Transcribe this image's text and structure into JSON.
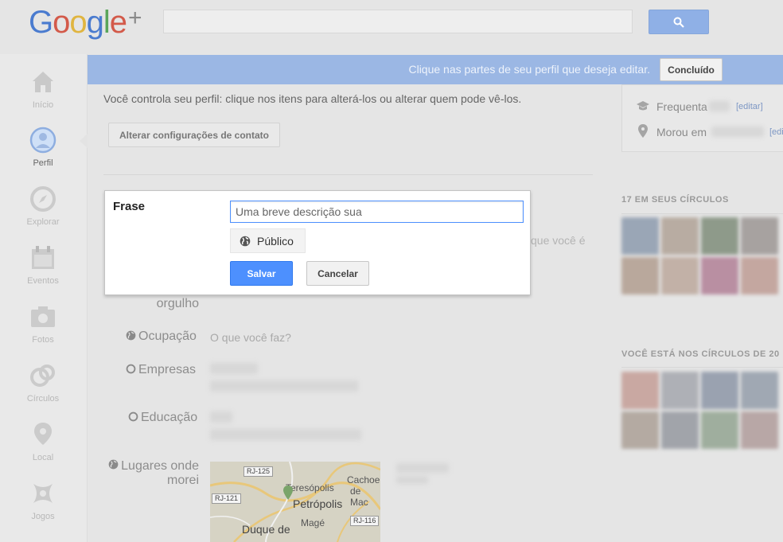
{
  "brand": {
    "logo": "Google",
    "plus": "+"
  },
  "search": {
    "value": ""
  },
  "nav": {
    "items": [
      {
        "label": "Início",
        "icon": "home-icon"
      },
      {
        "label": "Perfil",
        "icon": "profile-icon"
      },
      {
        "label": "Explorar",
        "icon": "compass-icon"
      },
      {
        "label": "Eventos",
        "icon": "calendar-icon"
      },
      {
        "label": "Fotos",
        "icon": "camera-icon"
      },
      {
        "label": "Círculos",
        "icon": "circles-icon"
      },
      {
        "label": "Local",
        "icon": "location-icon"
      },
      {
        "label": "Jogos",
        "icon": "games-icon"
      }
    ]
  },
  "banner": {
    "text": "Clique nas partes de seu perfil que deseja editar.",
    "done_label": "Concluído"
  },
  "main": {
    "intro": "Você controla seu perfil: clique nos itens para alterá-los ou alterar quem pode vê-los.",
    "contact_settings_label": "Alterar configurações de contato"
  },
  "dialog": {
    "label": "Frase",
    "input_placeholder": "Uma breve descrição sua",
    "visibility": "Público",
    "save_label": "Salvar",
    "cancel_label": "Cancelar",
    "behind_text": "que você é"
  },
  "profile": {
    "orgulho_label": "orgulho",
    "occupation_label": "Ocupação",
    "occupation_placeholder": "O que você faz?",
    "employment_label": "Empresas",
    "education_label": "Educação",
    "places_label_line1": "Lugares onde",
    "places_label_line2": "morei"
  },
  "map": {
    "labels": [
      "Teresópolis",
      "Petrópolis",
      "Duque de",
      "Magé",
      "Cachoe",
      "de Mac"
    ],
    "shields": [
      "RJ-125",
      "RJ-121",
      "RJ-116"
    ]
  },
  "right": {
    "frequenta_label": "Frequenta",
    "frequenta_edit": "[editar]",
    "morou_label": "Morou em",
    "morou_edit": "[edi",
    "circles_title": "17 EM SEUS CÍRCULOS",
    "in_circles_title": "VOCÊ ESTÁ NOS CÍRCULOS DE 20"
  },
  "colors": {
    "accent_blue": "#4d90fe",
    "banner_blue": "#9bb7e4",
    "page_bg": "#e5e5e5"
  }
}
